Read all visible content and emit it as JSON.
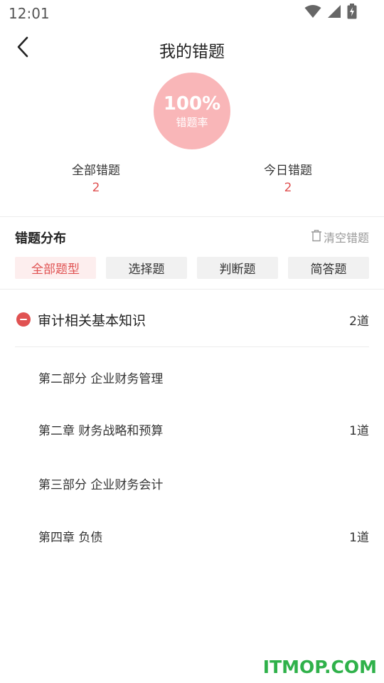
{
  "status_bar": {
    "time": "12:01"
  },
  "header": {
    "title": "我的错题"
  },
  "summary": {
    "rate_value": "100%",
    "rate_label": "错题率",
    "all_label": "全部错题",
    "all_value": "2",
    "today_label": "今日错题",
    "today_value": "2"
  },
  "distribution": {
    "title": "错题分布",
    "clear_label": "清空错题",
    "filters": [
      {
        "label": "全部题型",
        "active": true
      },
      {
        "label": "选择题",
        "active": false
      },
      {
        "label": "判断题",
        "active": false
      },
      {
        "label": "简答题",
        "active": false
      }
    ]
  },
  "group": {
    "label": "审计相关基本知识",
    "count": "2道"
  },
  "items": [
    {
      "label": "第二部分 企业财务管理",
      "count": ""
    },
    {
      "label": "第二章 财务战略和预算",
      "count": "1道"
    },
    {
      "label": "第三部分 企业财务会计",
      "count": ""
    },
    {
      "label": "第四章 负债",
      "count": "1道"
    }
  ],
  "watermark": "ITMOP.COM",
  "colors": {
    "accent": "#e05252",
    "circle": "#f9b6b8",
    "chip_active_bg": "#fdeeee",
    "watermark": "#2fb14a"
  }
}
